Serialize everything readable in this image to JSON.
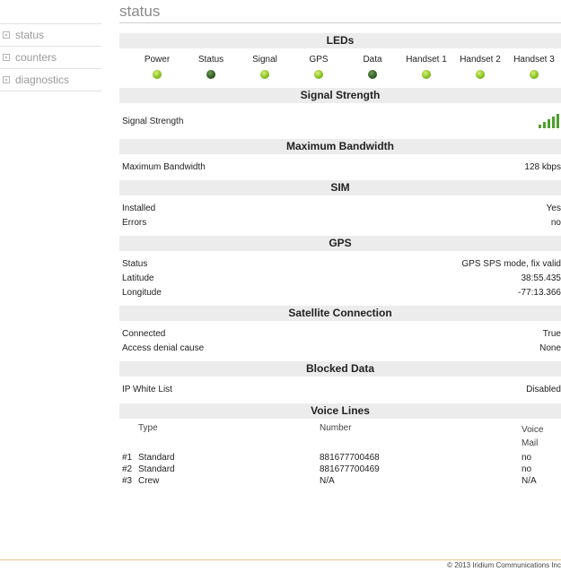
{
  "page": {
    "title": "status"
  },
  "sidebar": {
    "items": [
      {
        "label": "status"
      },
      {
        "label": "counters"
      },
      {
        "label": "diagnostics"
      }
    ]
  },
  "leds": {
    "title": "LEDs",
    "items": [
      {
        "label": "Power",
        "state": "on"
      },
      {
        "label": "Status",
        "state": "dim"
      },
      {
        "label": "Signal",
        "state": "on"
      },
      {
        "label": "GPS",
        "state": "on"
      },
      {
        "label": "Data",
        "state": "dim"
      },
      {
        "label": "Handset 1",
        "state": "on"
      },
      {
        "label": "Handset 2",
        "state": "on"
      },
      {
        "label": "Handset 3",
        "state": "on"
      }
    ],
    "colors": {
      "on": "#8ac321",
      "dim": "#2f5a23"
    }
  },
  "signal": {
    "title": "Signal Strength",
    "label": "Signal Strength",
    "bars": 5,
    "color": "#4e9f2c"
  },
  "bandwidth": {
    "title": "Maximum Bandwidth",
    "label": "Maximum Bandwidth",
    "value": "128 kbps"
  },
  "sim": {
    "title": "SIM",
    "rows": [
      {
        "label": "Installed",
        "value": "Yes"
      },
      {
        "label": "Errors",
        "value": "no"
      }
    ]
  },
  "gps": {
    "title": "GPS",
    "rows": [
      {
        "label": "Status",
        "value": "GPS SPS mode, fix valid"
      },
      {
        "label": "Latitude",
        "value": "38:55.435"
      },
      {
        "label": "Longitude",
        "value": "-77:13.366"
      }
    ]
  },
  "satellite": {
    "title": "Satellite Connection",
    "rows": [
      {
        "label": "Connected",
        "value": "True"
      },
      {
        "label": "Access denial cause",
        "value": "None"
      }
    ]
  },
  "blocked": {
    "title": "Blocked Data",
    "rows": [
      {
        "label": "IP White List",
        "value": "Disabled"
      }
    ]
  },
  "voice": {
    "title": "Voice Lines",
    "headers": {
      "type": "Type",
      "number": "Number",
      "voicemail": "Voice Mail"
    },
    "rows": [
      {
        "idx": "#1",
        "type": "Standard",
        "number": "881677700468",
        "vm": "no"
      },
      {
        "idx": "#2",
        "type": "Standard",
        "number": "881677700469",
        "vm": "no"
      },
      {
        "idx": "#3",
        "type": "Crew",
        "number": "N/A",
        "vm": "N/A"
      }
    ]
  },
  "footer": {
    "text": "© 2013 Iridium Communications Inc"
  }
}
